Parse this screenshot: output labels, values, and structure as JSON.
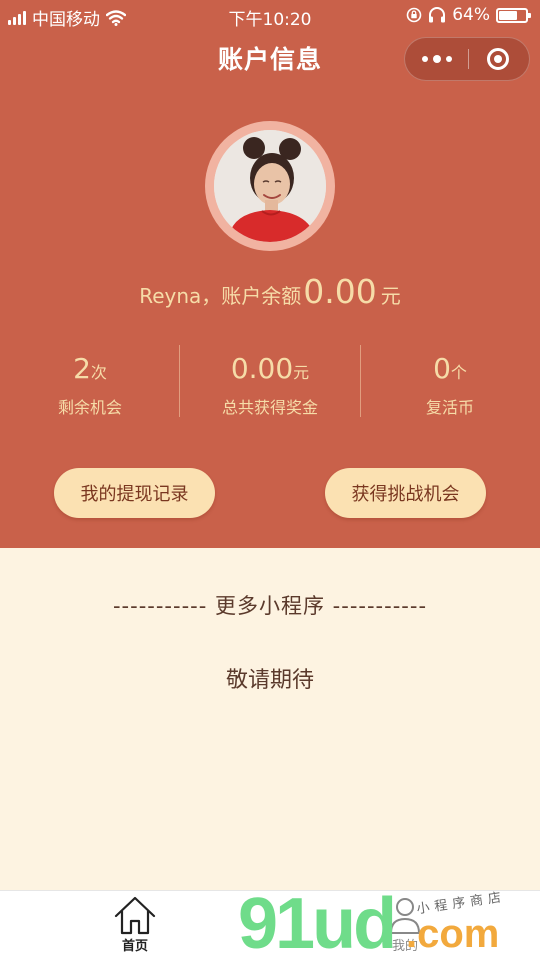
{
  "status_bar": {
    "carrier": "中国移动",
    "time": "下午10:20",
    "battery": "64%",
    "battery_level": 0.64
  },
  "nav": {
    "title": "账户信息"
  },
  "profile": {
    "name_prefix": "Reyna，账户余额",
    "balance": "0.00",
    "unit": "元"
  },
  "stats": [
    {
      "value": "2",
      "unit": "次",
      "label": "剩余机会"
    },
    {
      "value": "0.00",
      "unit": "元",
      "label": "总共获得奖金"
    },
    {
      "value": "0",
      "unit": "个",
      "label": "复活币"
    }
  ],
  "buttons": {
    "withdraw": "我的提现记录",
    "get_chance": "获得挑战机会"
  },
  "more": {
    "title": "----------- 更多小程序 -----------",
    "placeholder": "敬请期待"
  },
  "tabbar": {
    "home": "首页",
    "mine": "我的"
  },
  "watermark": {
    "brand": "91ud",
    "domain": ".com",
    "tagline": "小程序商店"
  },
  "colors": {
    "header_bg": "#c9614a",
    "body_bg": "#fdf3e1",
    "accent_text": "#f6dca8",
    "button_bg": "#fbe1b2"
  },
  "icons": [
    "signal-icon",
    "wifi-icon",
    "lock-rotation-icon",
    "headphones-icon",
    "battery-icon",
    "more-dots-icon",
    "close-target-icon",
    "home-icon",
    "user-icon"
  ]
}
